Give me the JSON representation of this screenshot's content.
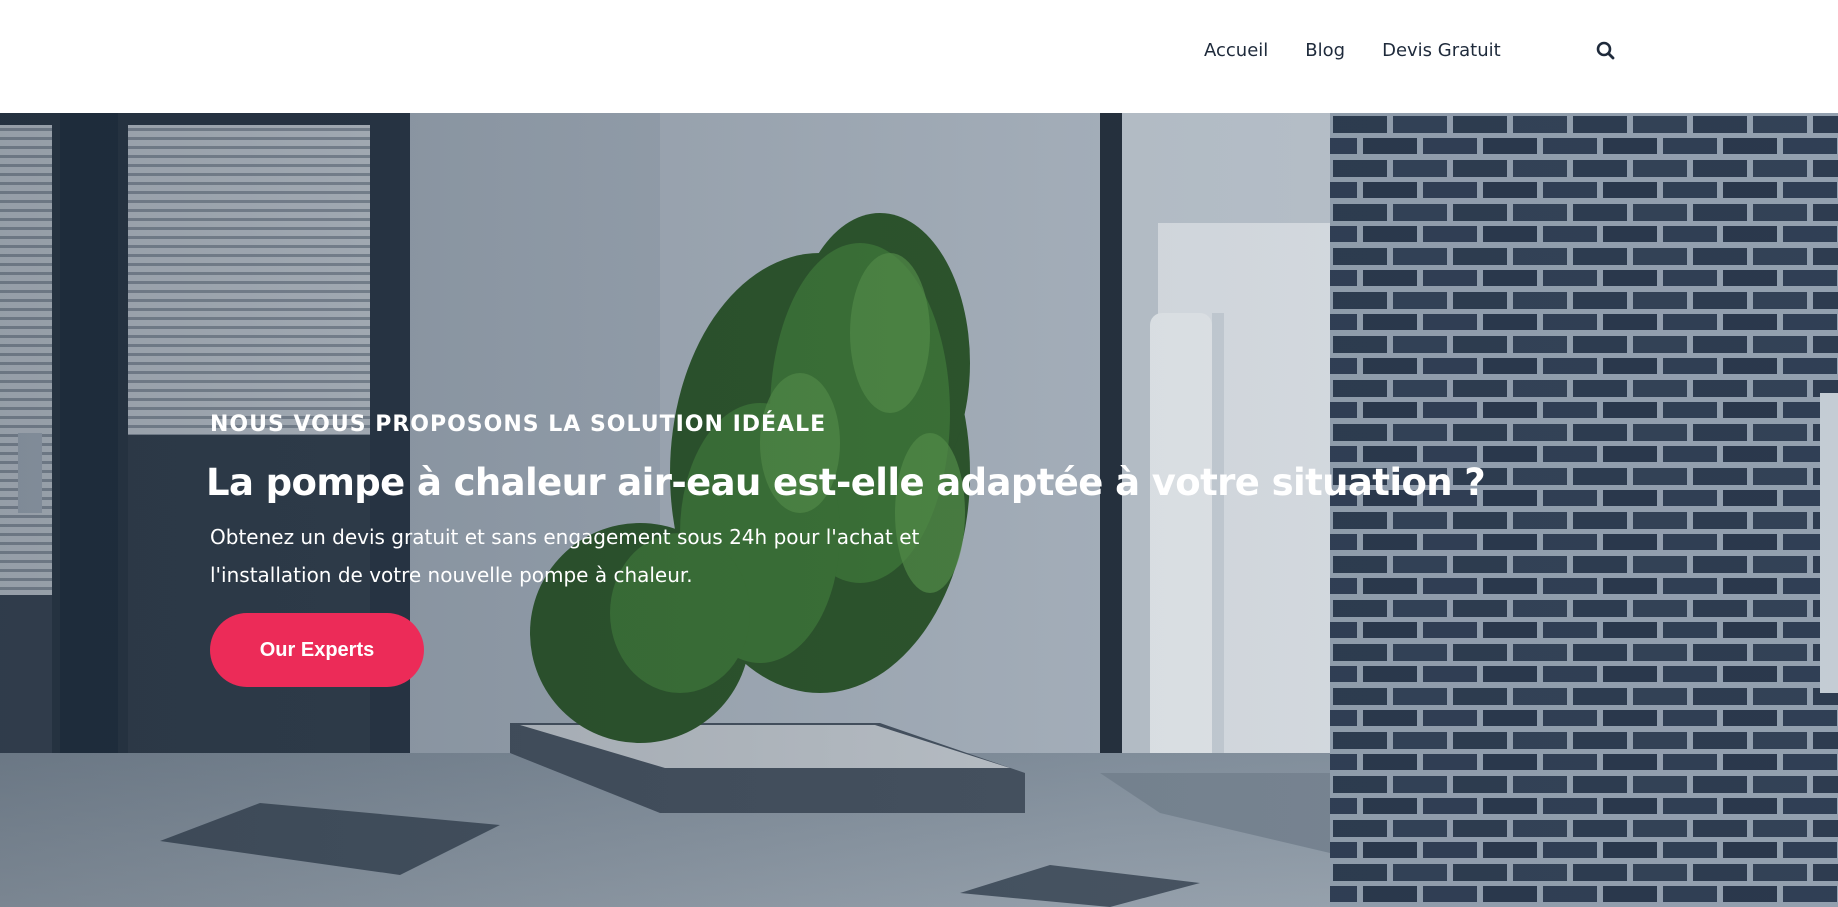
{
  "nav": {
    "items": [
      {
        "label": "Accueil"
      },
      {
        "label": "Blog"
      },
      {
        "label": "Devis Gratuit"
      }
    ],
    "search_icon": "search-icon"
  },
  "hero": {
    "eyebrow": "NOUS VOUS PROPOSONS LA SOLUTION IDÉALE",
    "headline": "La pompe à chaleur air-eau est-elle adaptée à votre situation ?",
    "subtext": "Obtenez un devis gratuit et sans engagement sous 24h pour l'achat et l'installation de votre nouvelle pompe à chaleur.",
    "cta_label": "Our Experts",
    "background_image": "house-exterior-heat-pump-photo"
  },
  "colors": {
    "accent": "#ec2b58",
    "nav_text": "#1e2a3b",
    "hero_text": "#ffffff"
  }
}
